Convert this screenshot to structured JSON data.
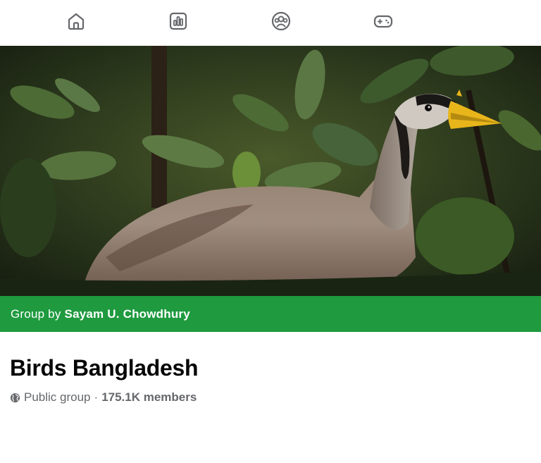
{
  "nav": {
    "items": [
      {
        "icon": "home-icon"
      },
      {
        "icon": "chart-icon"
      },
      {
        "icon": "groups-icon"
      },
      {
        "icon": "gaming-icon"
      }
    ]
  },
  "cover": {
    "photo_subject": "bird"
  },
  "group_bar": {
    "prefix": "Group by",
    "owner": "Sayam U. Chowdhury",
    "color": "#1f9a3f"
  },
  "group": {
    "title": "Birds Bangladesh",
    "privacy": "Public group",
    "separator": "·",
    "members": "175.1K members"
  },
  "colors": {
    "icon": "#65676b",
    "text": "#050505",
    "secondary": "#65676b"
  }
}
